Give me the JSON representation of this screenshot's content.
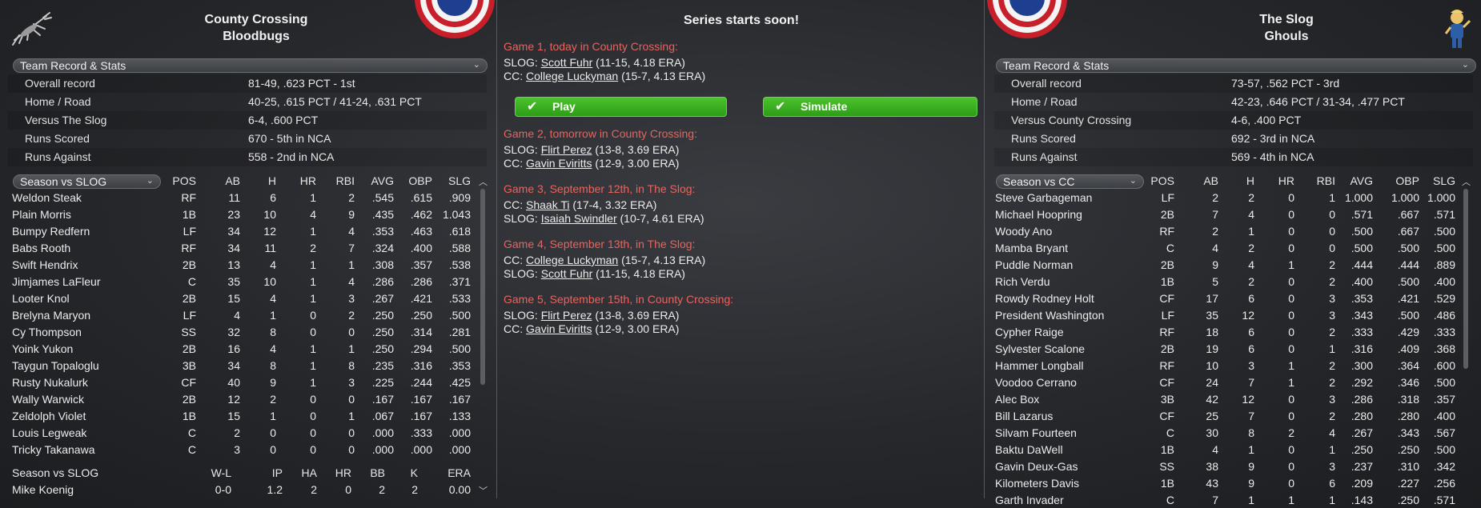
{
  "center": {
    "title": "Series starts soon!",
    "play_label": "Play",
    "simulate_label": "Simulate",
    "games": [
      {
        "head": "Game 1, today in County Crossing:",
        "lines": [
          {
            "team": "SLOG:",
            "pitcher": "Scott Fuhr",
            "stats": "(11-15, 4.18 ERA)"
          },
          {
            "team": "CC:",
            "pitcher": "College Luckyman",
            "stats": "(15-7, 4.13 ERA)"
          }
        ]
      },
      {
        "head": "Game 2, tomorrow in County Crossing:",
        "lines": [
          {
            "team": "SLOG:",
            "pitcher": "Flirt Perez",
            "stats": "(13-8, 3.69 ERA)"
          },
          {
            "team": "CC:",
            "pitcher": "Gavin Eviritts",
            "stats": "(12-9, 3.00 ERA)"
          }
        ]
      },
      {
        "head": "Game 3, September 12th,  in The Slog:",
        "lines": [
          {
            "team": "CC:",
            "pitcher": "Shaak Ti",
            "stats": "(17-4, 3.32 ERA)"
          },
          {
            "team": "SLOG:",
            "pitcher": "Isaiah Swindler",
            "stats": "(10-7, 4.61 ERA)"
          }
        ]
      },
      {
        "head": "Game 4, September 13th,  in The Slog:",
        "lines": [
          {
            "team": "CC:",
            "pitcher": "College Luckyman",
            "stats": "(15-7, 4.13 ERA)"
          },
          {
            "team": "SLOG:",
            "pitcher": "Scott Fuhr",
            "stats": "(11-15, 4.18 ERA)"
          }
        ]
      },
      {
        "head": "Game 5, September 15th,  in County Crossing:",
        "lines": [
          {
            "team": "SLOG:",
            "pitcher": "Flirt Perez",
            "stats": "(13-8, 3.69 ERA)"
          },
          {
            "team": "CC:",
            "pitcher": "Gavin Eviritts",
            "stats": "(12-9, 3.00 ERA)"
          }
        ]
      }
    ]
  },
  "left": {
    "city": "County Crossing",
    "team": "Bloodbugs",
    "logo_icon": "bloodbug-icon",
    "record_dropdown": "Team Record & Stats",
    "records": [
      {
        "label": "Overall record",
        "value": "81-49, .623 PCT - 1st"
      },
      {
        "label": "Home / Road",
        "value": "40-25, .615 PCT / 41-24, .631 PCT"
      },
      {
        "label": "Versus The Slog",
        "value": "6-4, .600 PCT"
      },
      {
        "label": "Runs Scored",
        "value": "670 - 5th in NCA"
      },
      {
        "label": "Runs Against",
        "value": "558 - 2nd in NCA"
      }
    ],
    "batting_dropdown": "Season vs SLOG",
    "batting_headers": [
      "POS",
      "AB",
      "H",
      "HR",
      "RBI",
      "AVG",
      "OBP",
      "SLG"
    ],
    "batters": [
      [
        "Weldon Steak",
        "RF",
        "11",
        "6",
        "1",
        "2",
        ".545",
        ".615",
        ".909"
      ],
      [
        "Plain Morris",
        "1B",
        "23",
        "10",
        "4",
        "9",
        ".435",
        ".462",
        "1.043"
      ],
      [
        "Bumpy Redfern",
        "LF",
        "34",
        "12",
        "1",
        "4",
        ".353",
        ".463",
        ".618"
      ],
      [
        "Babs Rooth",
        "RF",
        "34",
        "11",
        "2",
        "7",
        ".324",
        ".400",
        ".588"
      ],
      [
        "Swift Hendrix",
        "2B",
        "13",
        "4",
        "1",
        "1",
        ".308",
        ".357",
        ".538"
      ],
      [
        "Jimjames LaFleur",
        "C",
        "35",
        "10",
        "1",
        "4",
        ".286",
        ".286",
        ".371"
      ],
      [
        "Looter Knol",
        "2B",
        "15",
        "4",
        "1",
        "3",
        ".267",
        ".421",
        ".533"
      ],
      [
        "Brelyna Maryon",
        "LF",
        "4",
        "1",
        "0",
        "2",
        ".250",
        ".250",
        ".500"
      ],
      [
        "Cy Thompson",
        "SS",
        "32",
        "8",
        "0",
        "0",
        ".250",
        ".314",
        ".281"
      ],
      [
        "Yoink Yukon",
        "2B",
        "16",
        "4",
        "1",
        "1",
        ".250",
        ".294",
        ".500"
      ],
      [
        "Taygun Topaloglu",
        "3B",
        "34",
        "8",
        "1",
        "8",
        ".235",
        ".316",
        ".353"
      ],
      [
        "Rusty Nukalurk",
        "CF",
        "40",
        "9",
        "1",
        "3",
        ".225",
        ".244",
        ".425"
      ],
      [
        "Wally Warwick",
        "2B",
        "12",
        "2",
        "0",
        "0",
        ".167",
        ".167",
        ".167"
      ],
      [
        "Zeldolph Violet",
        "1B",
        "15",
        "1",
        "0",
        "1",
        ".067",
        ".167",
        ".133"
      ],
      [
        "Louis Legweak",
        "C",
        "2",
        "0",
        "0",
        "0",
        ".000",
        ".333",
        ".000"
      ],
      [
        "Tricky Takanawa",
        "C",
        "3",
        "0",
        "0",
        "0",
        ".000",
        ".000",
        ".000"
      ]
    ],
    "pitching_label": "Season vs SLOG",
    "pitching_headers": [
      "W-L",
      "IP",
      "HA",
      "HR",
      "BB",
      "K",
      "ERA"
    ],
    "pitchers": [
      [
        "Mike Koenig",
        "0-0",
        "1.2",
        "2",
        "0",
        "2",
        "2",
        "0.00"
      ]
    ]
  },
  "right": {
    "city": "The Slog",
    "team": "Ghouls",
    "logo_icon": "ghoul-mascot-icon",
    "record_dropdown": "Team Record & Stats",
    "records": [
      {
        "label": "Overall record",
        "value": "73-57, .562 PCT - 3rd"
      },
      {
        "label": "Home / Road",
        "value": "42-23, .646 PCT / 31-34, .477 PCT"
      },
      {
        "label": "Versus County Crossing",
        "value": "4-6, .400 PCT"
      },
      {
        "label": "Runs Scored",
        "value": "692 - 3rd in NCA"
      },
      {
        "label": "Runs Against",
        "value": "569 - 4th in NCA"
      }
    ],
    "batting_dropdown": "Season vs CC",
    "batting_headers": [
      "POS",
      "AB",
      "H",
      "HR",
      "RBI",
      "AVG",
      "OBP",
      "SLG"
    ],
    "batters": [
      [
        "Steve Garbageman",
        "LF",
        "2",
        "2",
        "0",
        "1",
        "1.000",
        "1.000",
        "1.000"
      ],
      [
        "Michael Hoopring",
        "2B",
        "7",
        "4",
        "0",
        "0",
        ".571",
        ".667",
        ".571"
      ],
      [
        "Woody Ano",
        "RF",
        "2",
        "1",
        "0",
        "0",
        ".500",
        ".667",
        ".500"
      ],
      [
        "Mamba Bryant",
        "C",
        "4",
        "2",
        "0",
        "0",
        ".500",
        ".500",
        ".500"
      ],
      [
        "Puddle Norman",
        "2B",
        "9",
        "4",
        "1",
        "2",
        ".444",
        ".444",
        ".889"
      ],
      [
        "Rich Verdu",
        "1B",
        "5",
        "2",
        "0",
        "2",
        ".400",
        ".500",
        ".400"
      ],
      [
        "Rowdy Rodney Holt",
        "CF",
        "17",
        "6",
        "0",
        "3",
        ".353",
        ".421",
        ".529"
      ],
      [
        "President Washington",
        "LF",
        "35",
        "12",
        "0",
        "3",
        ".343",
        ".500",
        ".486"
      ],
      [
        "Cypher Raige",
        "RF",
        "18",
        "6",
        "0",
        "2",
        ".333",
        ".429",
        ".333"
      ],
      [
        "Sylvester Scalone",
        "2B",
        "19",
        "6",
        "0",
        "1",
        ".316",
        ".409",
        ".368"
      ],
      [
        "Hammer Longball",
        "RF",
        "10",
        "3",
        "1",
        "2",
        ".300",
        ".364",
        ".600"
      ],
      [
        "Voodoo Cerrano",
        "CF",
        "24",
        "7",
        "1",
        "2",
        ".292",
        ".346",
        ".500"
      ],
      [
        "Alec Box",
        "3B",
        "42",
        "12",
        "0",
        "3",
        ".286",
        ".318",
        ".357"
      ],
      [
        "Bill Lazarus",
        "CF",
        "25",
        "7",
        "0",
        "2",
        ".280",
        ".280",
        ".400"
      ],
      [
        "Silvam Fourteen",
        "C",
        "30",
        "8",
        "2",
        "4",
        ".267",
        ".343",
        ".567"
      ],
      [
        "Baktu DaWell",
        "1B",
        "4",
        "1",
        "0",
        "1",
        ".250",
        ".250",
        ".500"
      ],
      [
        "Gavin Deux-Gas",
        "SS",
        "38",
        "9",
        "0",
        "3",
        ".237",
        ".310",
        ".342"
      ],
      [
        "Kilometers Davis",
        "1B",
        "43",
        "9",
        "0",
        "6",
        ".209",
        ".227",
        ".256"
      ],
      [
        "Garth Invader",
        "C",
        "7",
        "1",
        "1",
        "1",
        ".143",
        ".250",
        ".571"
      ]
    ]
  },
  "colors": {
    "game_head": "#e8645f",
    "button_green": "#3bb01f"
  }
}
